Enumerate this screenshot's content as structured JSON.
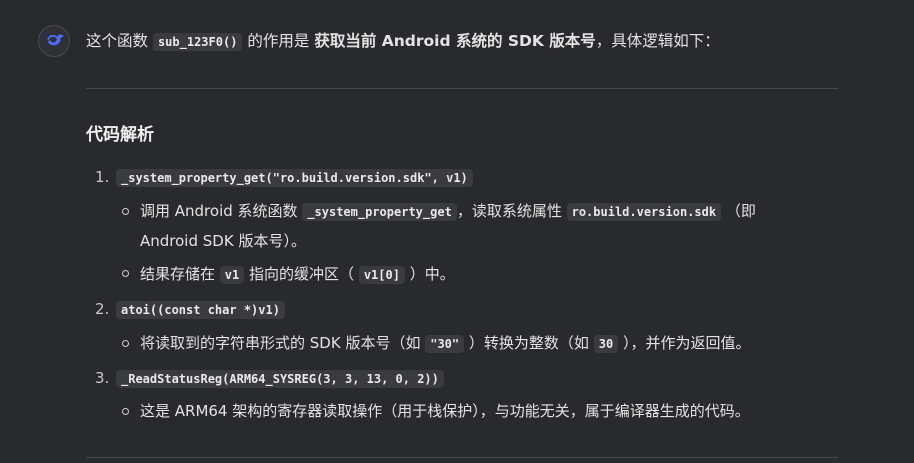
{
  "intro": {
    "prefix": "这个函数",
    "func_code": "sub_123F0()",
    "middle": "的作用是",
    "bold": "获取当前 Android 系统的 SDK 版本号",
    "suffix": "，具体逻辑如下："
  },
  "section": {
    "title": "代码解析"
  },
  "items": [
    {
      "number": "1.",
      "code": "_system_property_get(\"ro.build.version.sdk\", v1)",
      "bullets": [
        {
          "t1": "调用 Android 系统函数",
          "c1": "_system_property_get",
          "t2": "，读取系统属性",
          "c2": "ro.build.version.sdk",
          "t3": "（即",
          "t4": "Android SDK 版本号）。"
        },
        {
          "t1": "结果存储在",
          "c1": "v1",
          "t2": "指向的缓冲区（",
          "c2": "v1[0]",
          "t3": "）中。"
        }
      ]
    },
    {
      "number": "2.",
      "code": "atoi((const char *)v1)",
      "bullets": [
        {
          "t1": "将读取到的字符串形式的 SDK 版本号（如",
          "c1": "\"30\"",
          "t2": "）转换为整数（如",
          "c2": "30",
          "t3": "），并作为返回值。"
        }
      ]
    },
    {
      "number": "3.",
      "code": "_ReadStatusReg(ARM64_SYSREG(3, 3, 13, 0, 2))",
      "bullets": [
        {
          "t1": "这是 ARM64 架构的寄存器读取操作（用于栈保护），与功能无关，属于编译器生成的代码。"
        }
      ]
    }
  ],
  "colors": {
    "background": "#292a2d",
    "text": "#e3e3e3",
    "code_bg": "#3a3b40",
    "avatar_accent": "#4d6bfe"
  },
  "icons": {
    "avatar": "whale-logo-icon",
    "list_marker": "hollow-circle-icon"
  }
}
